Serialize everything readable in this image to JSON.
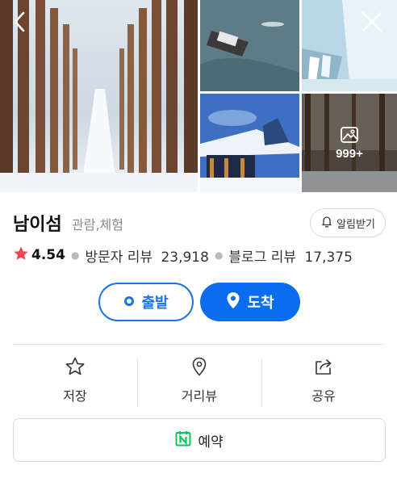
{
  "gallery": {
    "more_count": "999+",
    "photos": [
      "snowy-tree-avenue",
      "ferry-on-river",
      "frozen-waterfall",
      "snowy-pavilion",
      "snowy-park"
    ]
  },
  "nav": {
    "back_icon": "chevron-left-icon",
    "close_icon": "close-icon"
  },
  "place": {
    "name": "남이섬",
    "category": "관람,체험",
    "alarm_label": "알림받기"
  },
  "rating": {
    "star_color": "#f0444a",
    "score": "4.54",
    "visitor_label": "방문자 리뷰",
    "visitor_count": "23,918",
    "blog_label": "블로그 리뷰",
    "blog_count": "17,375"
  },
  "directions": {
    "start_label": "출발",
    "arrive_label": "도착",
    "accent": "#0a6cf0"
  },
  "actions": [
    {
      "label": "저장",
      "icon": "star-icon"
    },
    {
      "label": "거리뷰",
      "icon": "map-pin-icon"
    },
    {
      "label": "공유",
      "icon": "share-icon"
    }
  ],
  "reserve": {
    "label": "예약",
    "icon_color": "#03c75a"
  }
}
